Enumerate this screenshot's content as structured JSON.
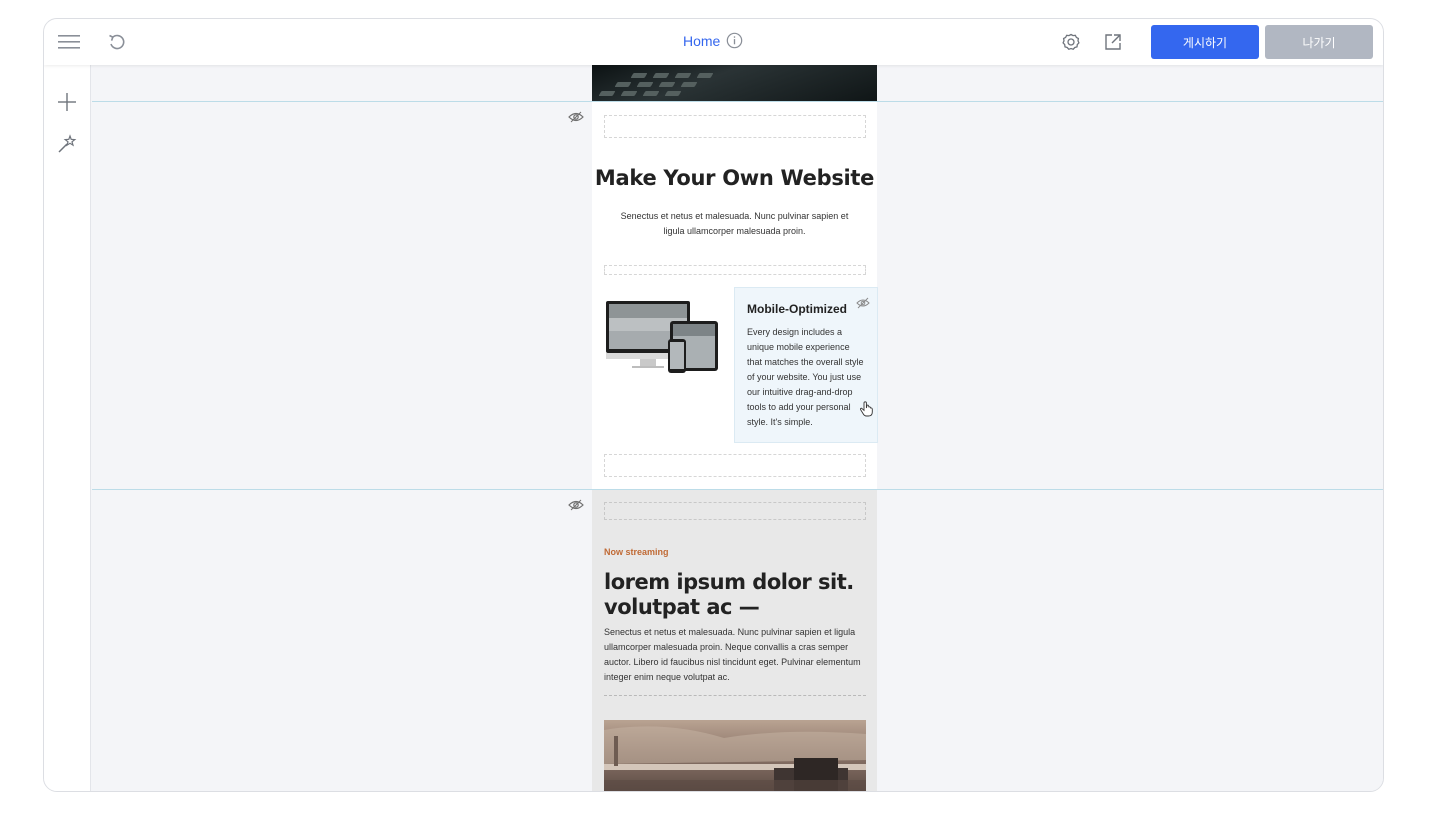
{
  "topbar": {
    "page_title": "Home",
    "publish_label": "게시하기",
    "exit_label": "나가기",
    "icons": [
      "menu-icon",
      "undo-icon",
      "info-icon",
      "gear-icon",
      "external-link-icon"
    ]
  },
  "leftbar": {
    "icons": [
      "plus-icon",
      "magic-wand-icon"
    ]
  },
  "section1": {
    "heading": "Make Your Own Website",
    "body": "Senectus et netus et malesuada. Nunc pulvinar sapien et ligula ullamcorper malesuada proin.",
    "feature": {
      "title": "Mobile-Optimized",
      "text": "Every design includes a unique mobile experience that matches the overall style of your website. You just use our intuitive drag-and-drop tools to add your personal style. It's simple."
    }
  },
  "section2": {
    "kicker": "Now streaming",
    "heading": "lorem ipsum dolor sit. volutpat ac —",
    "body": "Senectus et netus et malesuada. Nunc pulvinar sapien et ligula ullamcorper malesuada proin. Neque convallis a cras semper auctor. Libero id faucibus nisl tincidunt eget. Pulvinar elementum integer enim neque volutpat ac."
  },
  "colors": {
    "accent": "#3467ef",
    "exit_button": "#b1b7c2",
    "kicker": "#c06a35",
    "canvas_bg": "#f4f5f8",
    "section_line": "#bcdce8"
  }
}
